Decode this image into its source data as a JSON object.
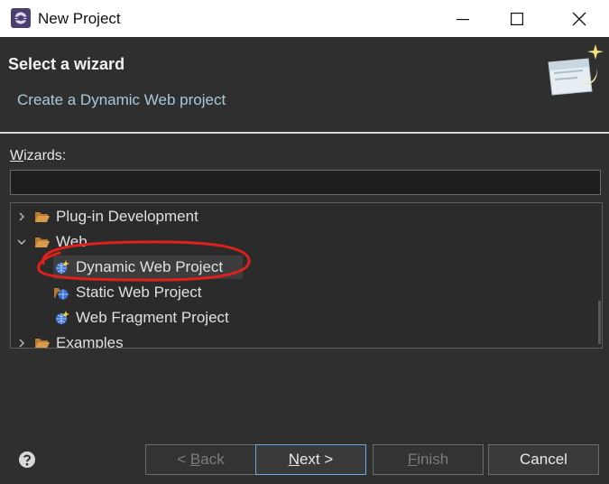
{
  "window": {
    "title": "New Project"
  },
  "header": {
    "title": "Select a wizard",
    "description": "Create a Dynamic Web project"
  },
  "wizards": {
    "label_mnemonic": "W",
    "label_rest": "izards:",
    "filter_value": ""
  },
  "tree": {
    "items": [
      {
        "label": "Plug-in Development",
        "type": "category",
        "expanded": false
      },
      {
        "label": "Web",
        "type": "category",
        "expanded": true
      },
      {
        "label": "Dynamic Web Project",
        "type": "wizard",
        "selected": true
      },
      {
        "label": "Static Web Project",
        "type": "wizard"
      },
      {
        "label": "Web Fragment Project",
        "type": "wizard"
      },
      {
        "label": "Examples",
        "type": "category",
        "expanded": false
      }
    ]
  },
  "buttons": {
    "back_prefix": "< ",
    "back_mnemonic": "B",
    "back_rest": "ack",
    "next_mnemonic": "N",
    "next_rest": "ext >",
    "finish_mnemonic": "F",
    "finish_rest": "inish",
    "cancel": "Cancel"
  },
  "colors": {
    "background": "#2f2f2f",
    "description_text": "#a9c9d9",
    "default_button_border": "#6aa7df",
    "annotation": "#e0201b",
    "folder": "#c98a3c"
  },
  "icons": [
    "eclipse-app-icon",
    "minimize-icon",
    "maximize-icon",
    "close-icon",
    "wizard-banner-icon",
    "chevron-right-icon",
    "chevron-down-icon",
    "folder-open-icon",
    "web-project-icon",
    "help-icon"
  ]
}
